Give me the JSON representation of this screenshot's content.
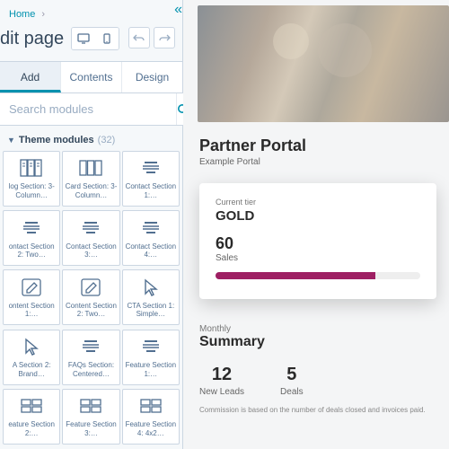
{
  "breadcrumb": {
    "home": "Home"
  },
  "page_title": "dit page",
  "tabs": {
    "add": "Add",
    "contents": "Contents",
    "design": "Design"
  },
  "search": {
    "placeholder": "Search modules"
  },
  "section": {
    "label": "Theme modules",
    "count": "(32)"
  },
  "modules": [
    {
      "label": "log Section: 3-Column…",
      "icon": "cols-text"
    },
    {
      "label": "Card Section: 3-Column…",
      "icon": "cards"
    },
    {
      "label": "Contact Section 1:…",
      "icon": "lines"
    },
    {
      "label": "ontact Section 2: Two…",
      "icon": "lines"
    },
    {
      "label": "Contact Section 3:…",
      "icon": "lines"
    },
    {
      "label": "Contact Section 4:…",
      "icon": "lines"
    },
    {
      "label": "ontent Section 1:…",
      "icon": "pencil"
    },
    {
      "label": "Content Section 2: Two…",
      "icon": "pencil"
    },
    {
      "label": "CTA Section 1: Simple…",
      "icon": "cursor"
    },
    {
      "label": "A Section 2: Brand…",
      "icon": "cursor"
    },
    {
      "label": "FAQs Section: Centered…",
      "icon": "lines"
    },
    {
      "label": "Feature Section 1:…",
      "icon": "lines"
    },
    {
      "label": "eature Section 2:…",
      "icon": "grid"
    },
    {
      "label": "Feature Section 3:…",
      "icon": "grid"
    },
    {
      "label": "Feature Section 4: 4x2…",
      "icon": "grid"
    }
  ],
  "portal": {
    "title": "Partner Portal",
    "subtitle": "Example Portal",
    "tier_label": "Current tier",
    "tier_value": "GOLD",
    "metric_value": "60",
    "metric_label": "Sales",
    "monthly_label": "Monthly",
    "summary_title": "Summary",
    "stats": [
      {
        "value": "12",
        "label": "New Leads"
      },
      {
        "value": "5",
        "label": "Deals"
      }
    ],
    "footnote": "Commission is based on the number of deals closed and invoices paid."
  }
}
